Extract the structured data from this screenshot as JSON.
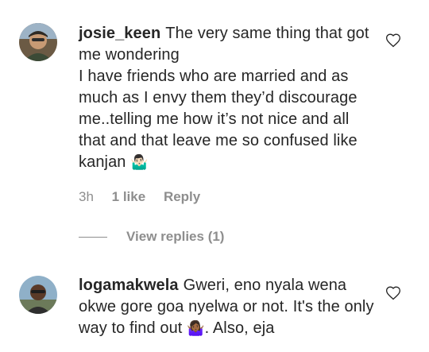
{
  "comments": [
    {
      "username": "josie_keen",
      "text": "The very same thing that got me wondering",
      "text2": "I have friends who are married and as much as I envy them they’d discourage me..telling me how it’s not nice and all that and that leave me so confused like kanjan",
      "emoji": "🤷🏻‍♂️",
      "time": "3h",
      "likes": "1 like",
      "reply_label": "Reply",
      "view_replies": "View replies (1)",
      "avatar_icon": "user-avatar-photo",
      "like_icon": "heart-outline-icon"
    },
    {
      "username": "logamakwela",
      "text": "Gweri, eno nyala wena okwe gore goa nyelwa or not. It's the only way to find out",
      "emoji": "🤷🏾‍♀️",
      "text_after": ". Also, eja",
      "avatar_icon": "user-avatar-photo",
      "like_icon": "heart-outline-icon"
    }
  ],
  "colors": {
    "text": "#262626",
    "muted": "#8e8e8e",
    "background": "#ffffff"
  }
}
